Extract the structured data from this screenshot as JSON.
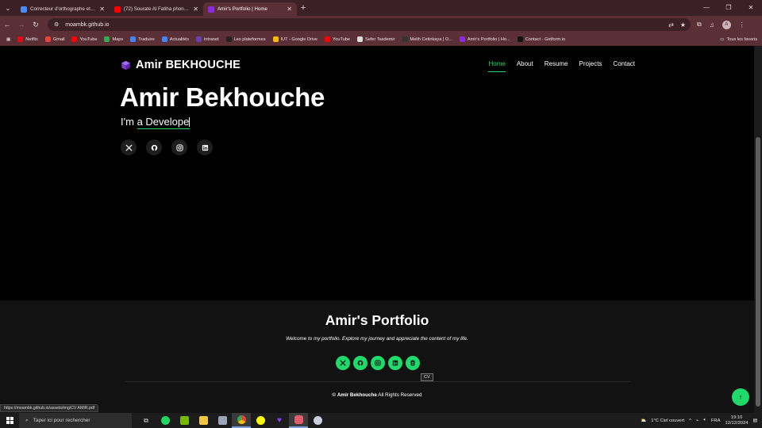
{
  "browser": {
    "tabs": [
      {
        "title": "Correcteur d'orthographe et de",
        "color": "#4a8af4",
        "active": false
      },
      {
        "title": "(72) Sourate Al Fatiha phonétiq",
        "color": "#ff0000",
        "active": false
      },
      {
        "title": "Amir's Portfolio | Home",
        "color": "#8a2be2",
        "active": true
      }
    ],
    "url": "moambk.github.io",
    "bookmarks": [
      {
        "label": "Netflix",
        "color": "#e50914"
      },
      {
        "label": "Gmail",
        "color": "#ea4335"
      },
      {
        "label": "YouTube",
        "color": "#ff0000"
      },
      {
        "label": "Maps",
        "color": "#34a853"
      },
      {
        "label": "Traduire",
        "color": "#4285f4"
      },
      {
        "label": "Actualités",
        "color": "#4285f4"
      },
      {
        "label": "intranet",
        "color": "#6a3fb5"
      },
      {
        "label": "Les plateformes",
        "color": "#222222"
      },
      {
        "label": "IUT - Google Drive",
        "color": "#fbbc04"
      },
      {
        "label": "YouTube",
        "color": "#ff0000"
      },
      {
        "label": "Sefer Tasdemir",
        "color": "#dddddd"
      },
      {
        "label": "Melih Cetinkaya | O...",
        "color": "#333333"
      },
      {
        "label": "Amir's Portfolio | Ho...",
        "color": "#8a2be2"
      },
      {
        "label": "Contact - Getform.io",
        "color": "#111111"
      }
    ],
    "all_bookmarks": "Tous les favoris",
    "status_url": "https://moambk.github.io/assets/img/CV AMIR.pdf"
  },
  "header": {
    "brand": "Amir BEKHOUCHE",
    "nav": [
      {
        "label": "Home",
        "active": true
      },
      {
        "label": "About",
        "active": false
      },
      {
        "label": "Resume",
        "active": false
      },
      {
        "label": "Projects",
        "active": false
      },
      {
        "label": "Contact",
        "active": false
      }
    ]
  },
  "hero": {
    "name": "Amir Bekhouche",
    "prefix": "I'm",
    "typed": "a Develope"
  },
  "footer": {
    "title": "Amir's Portfolio",
    "tagline": "Welcome to my portfolio. Explore my journey and appreciate the content of my life.",
    "tooltip": "CV",
    "copyright_symbol": "©",
    "copyright_name": "Amir Bekhouche",
    "copyright_rest": "All Rights Reserved"
  },
  "taskbar": {
    "search_placeholder": "Taper ici pour rechercher",
    "weather": "1°C  Ciel couvert",
    "language": "FRA",
    "time": "19:10",
    "date": "12/12/2024"
  },
  "colors": {
    "accent": "#1fd96b",
    "chrome": "#5a2f36",
    "page_bg": "#000000",
    "footer_bg": "#121212"
  }
}
